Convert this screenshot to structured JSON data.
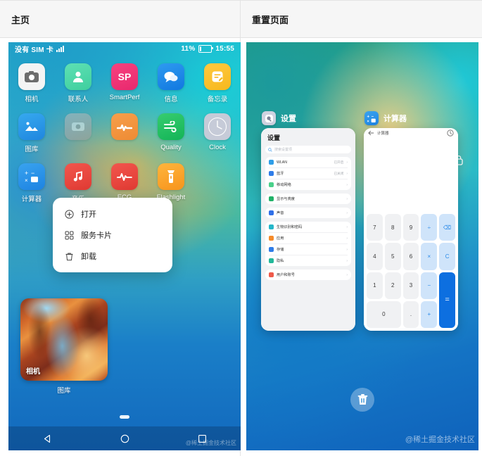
{
  "table": {
    "headers": [
      "主页",
      "重置页面"
    ]
  },
  "home": {
    "status": {
      "carrier": "没有 SIM 卡",
      "signal_icon": "signal-bars-icon",
      "battery_percent": "11%",
      "battery_icon": "battery-low-icon",
      "time": "15:55"
    },
    "apps_row1": [
      {
        "label": "相机",
        "icon": "camera-icon"
      },
      {
        "label": "联系人",
        "icon": "contacts-icon"
      },
      {
        "label": "SmartPerf",
        "icon": "smartperf-icon",
        "glyph": "SP"
      },
      {
        "label": "信息",
        "icon": "messages-icon"
      },
      {
        "label": "备忘录",
        "icon": "notes-icon"
      }
    ],
    "apps_row2": [
      {
        "label": "图库",
        "icon": "gallery-icon"
      },
      {
        "label": "",
        "icon": "music-placeholder-icon"
      },
      {
        "label": "",
        "icon": "health-icon"
      },
      {
        "label": "Quality",
        "icon": "quality-icon"
      },
      {
        "label": "Clock",
        "icon": "clock-icon"
      }
    ],
    "apps_row3": [
      {
        "label": "计算器",
        "icon": "calculator-icon"
      },
      {
        "label": "音乐",
        "icon": "music-icon"
      },
      {
        "label": "ECG",
        "icon": "ecg-icon"
      },
      {
        "label": "Flashlight",
        "icon": "flashlight-icon"
      }
    ],
    "context_menu": [
      {
        "label": "打开",
        "icon": "plus-circle-icon"
      },
      {
        "label": "服务卡片",
        "icon": "service-card-icon"
      },
      {
        "label": "卸载",
        "icon": "trash-icon"
      }
    ],
    "widget": {
      "tag": "相机",
      "label": "图库"
    },
    "nav": [
      {
        "name": "back-button",
        "icon": "triangle-back-icon"
      },
      {
        "name": "home-button",
        "icon": "circle-home-icon"
      },
      {
        "name": "recents-button",
        "icon": "square-recents-icon"
      }
    ],
    "watermark": "@稀土掘金技术社区"
  },
  "recents": {
    "tasks": [
      {
        "title": "设置",
        "icon": "settings-icon"
      },
      {
        "title": "计算器",
        "icon": "calculator-icon"
      }
    ],
    "lock_icon": "lock-icon",
    "settings_card": {
      "title": "设置",
      "search_placeholder": "搜索设置项",
      "search_icon": "search-icon",
      "groups": [
        [
          {
            "label": "WLAN",
            "value": "已开启",
            "color": "#2f9ee8"
          },
          {
            "label": "蓝牙",
            "value": "已关闭",
            "color": "#2f7ce8"
          },
          {
            "label": "移动网络",
            "value": "",
            "color": "#4ad08a"
          }
        ],
        [
          {
            "label": "显示与亮度",
            "value": "",
            "color": "#20b268"
          }
        ],
        [
          {
            "label": "声音",
            "value": "",
            "color": "#2f6fe8"
          }
        ],
        [
          {
            "label": "生物识别和密码",
            "value": "",
            "color": "#24b6c9"
          },
          {
            "label": "应用",
            "value": "",
            "color": "#f58a2a"
          },
          {
            "label": "存储",
            "value": "",
            "color": "#2f7ce8"
          },
          {
            "label": "隐私",
            "value": "",
            "color": "#22b89a"
          }
        ],
        [
          {
            "label": "用户和账号",
            "value": "",
            "color": "#ef5a4a"
          }
        ]
      ],
      "arrow_glyph": "›"
    },
    "calculator_card": {
      "back_icon": "back-arrow-icon",
      "title": "计算器",
      "history_icon": "history-icon",
      "keys": [
        {
          "label": "7",
          "type": "num"
        },
        {
          "label": "8",
          "type": "num"
        },
        {
          "label": "9",
          "type": "num"
        },
        {
          "label": "÷",
          "type": "op"
        },
        {
          "label": "⌫",
          "type": "op"
        },
        {
          "label": "4",
          "type": "num"
        },
        {
          "label": "5",
          "type": "num"
        },
        {
          "label": "6",
          "type": "num"
        },
        {
          "label": "×",
          "type": "op"
        },
        {
          "label": "C",
          "type": "op"
        },
        {
          "label": "1",
          "type": "num"
        },
        {
          "label": "2",
          "type": "num"
        },
        {
          "label": "3",
          "type": "num"
        },
        {
          "label": "−",
          "type": "op"
        },
        {
          "label": "=",
          "type": "eq"
        },
        {
          "label": "0",
          "type": "zero"
        },
        {
          "label": ".",
          "type": "num"
        },
        {
          "label": "+",
          "type": "op"
        }
      ]
    },
    "delete_icon": "trash-icon",
    "watermark": "@稀土掘金技术社区"
  }
}
